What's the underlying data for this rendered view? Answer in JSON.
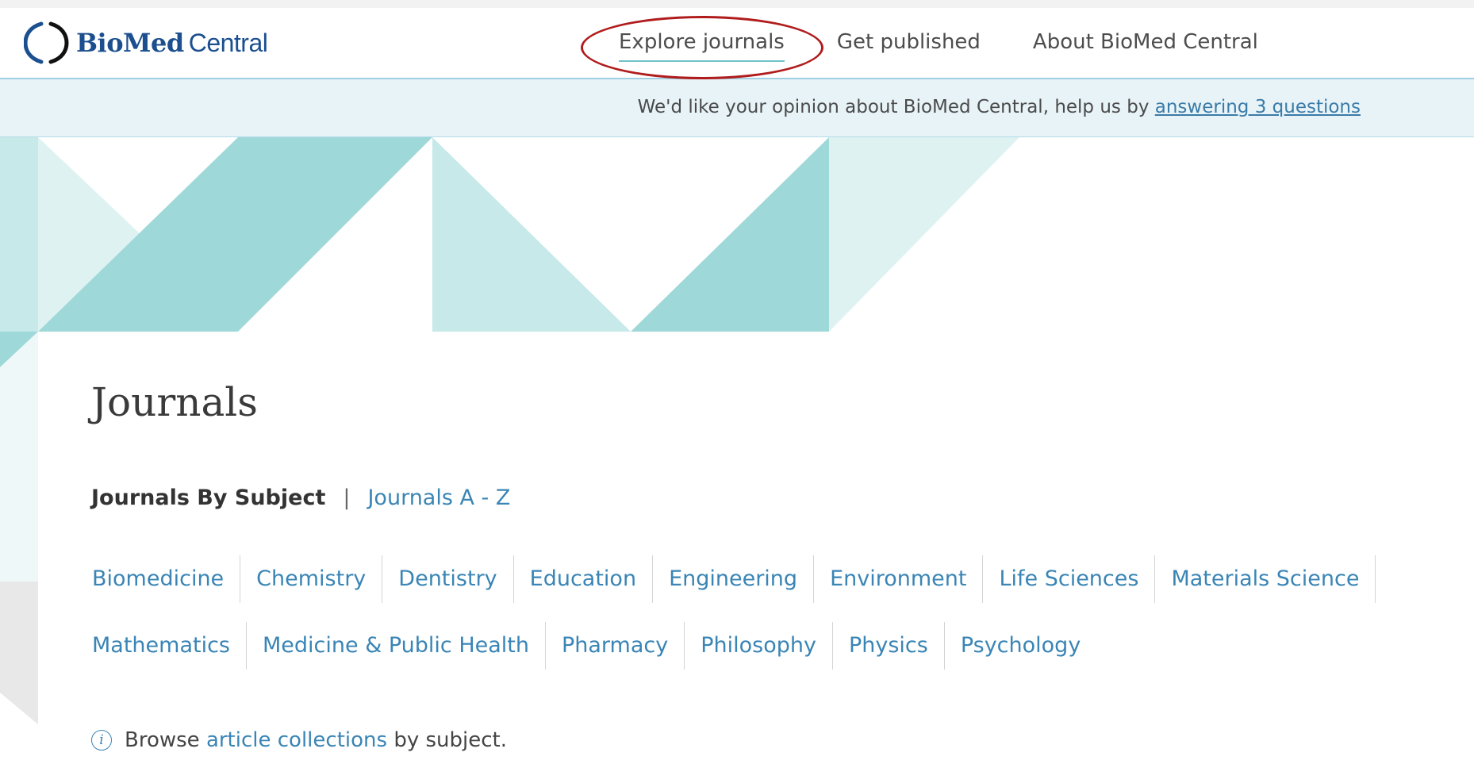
{
  "header": {
    "logo_bold": "BioMed",
    "logo_light": "Central",
    "nav": [
      {
        "label": "Explore journals"
      },
      {
        "label": "Get published"
      },
      {
        "label": "About BioMed Central"
      }
    ]
  },
  "survey": {
    "text": "We'd like your opinion about BioMed Central, help us by ",
    "link": "answering 3 questions"
  },
  "main": {
    "title": "Journals",
    "tabs": {
      "current": "Journals By Subject",
      "separator": "|",
      "other": "Journals A - Z"
    },
    "subjects_row1": [
      "Biomedicine",
      "Chemistry",
      "Dentistry",
      "Education",
      "Engineering",
      "Environment",
      "Life Sciences",
      "Materials Science"
    ],
    "subjects_row2": [
      "Mathematics",
      "Medicine & Public Health",
      "Pharmacy",
      "Philosophy",
      "Physics",
      "Psychology"
    ],
    "browse": {
      "prefix": "Browse ",
      "link": "article collections",
      "suffix": " by subject."
    }
  },
  "colors": {
    "teal_dark": "#9fd8d8",
    "teal_light": "#c7e9e9",
    "teal_pale": "#dff2f2",
    "link": "#3a85b5",
    "brand": "#1b4f8f",
    "highlight": "#b01c1c"
  },
  "icons": [
    "biomed-logo-icon",
    "info-icon"
  ]
}
